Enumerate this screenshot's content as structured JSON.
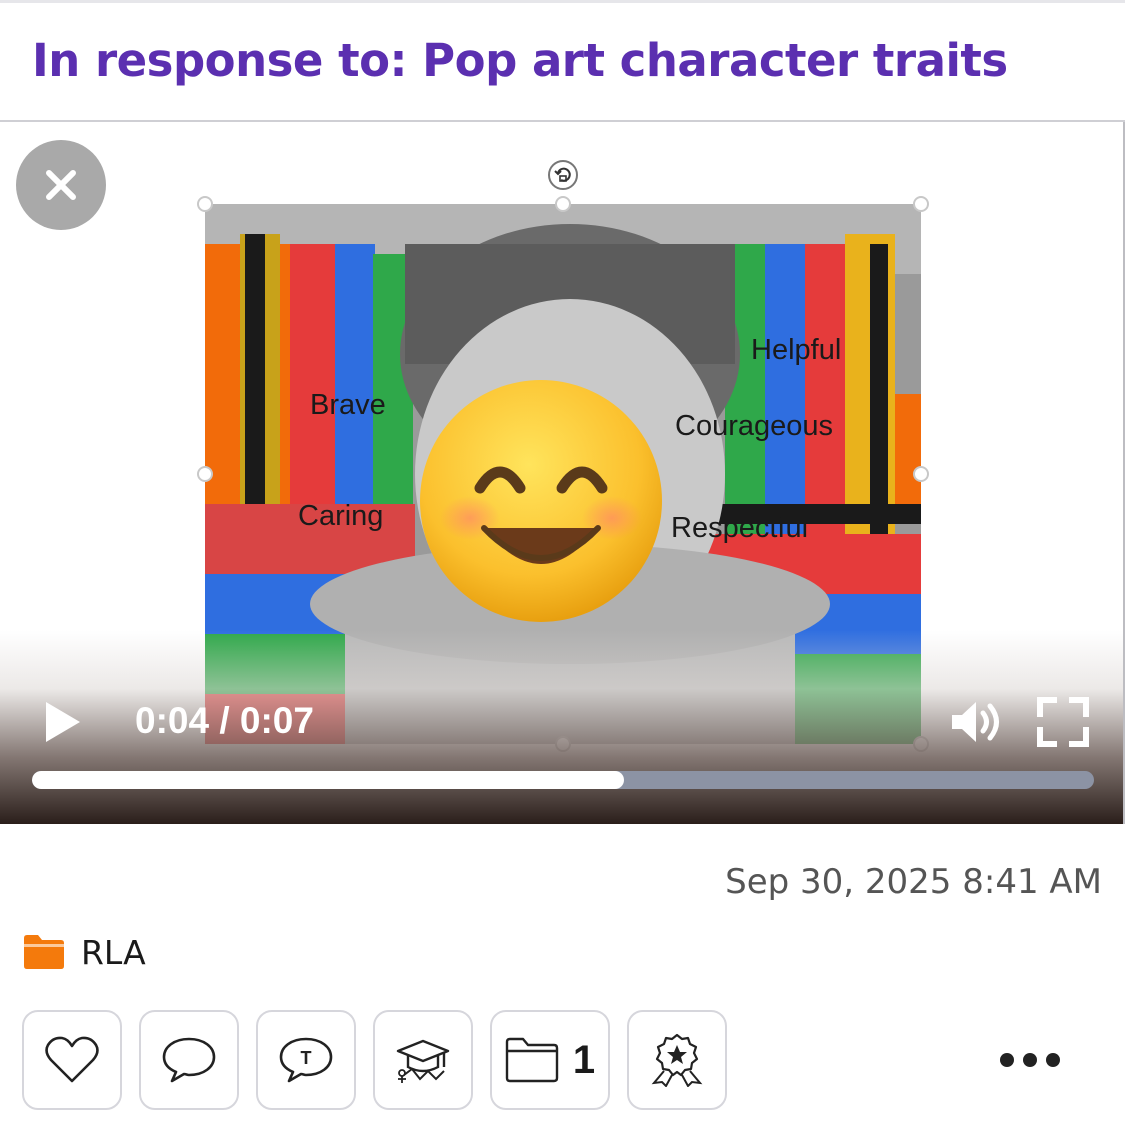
{
  "header": {
    "title": "In response to: Pop art character traits"
  },
  "video": {
    "art_words": [
      "Brave",
      "Caring",
      "Helpful",
      "Courageous",
      "Respectful"
    ],
    "elapsed": "0:04",
    "separator": " / ",
    "duration": "0:07",
    "progress_fraction": 0.557,
    "icons": {
      "close": "close-icon",
      "rotate": "rotate-icon",
      "play": "play-icon",
      "volume": "volume-icon",
      "fullscreen": "fullscreen-icon",
      "face_overlay": "smiling-face-emoji"
    }
  },
  "post": {
    "timestamp": "Sep 30, 2025 8:41 AM",
    "folder": {
      "icon": "folder-icon",
      "color": "#f47a0c",
      "label": "RLA"
    }
  },
  "actions": {
    "like_icon": "heart-icon",
    "comment_icon": "comment-icon",
    "teacher_comment_icon": "teacher-comment-icon",
    "skills_icon": "graduation-cap-icon",
    "folders_icon": "folder-icon",
    "folders_count": "1",
    "badge_icon": "award-badge-icon",
    "more_icon": "more-icon"
  },
  "colors": {
    "title": "#5b2fb0",
    "accent_orange": "#f47a0c"
  }
}
